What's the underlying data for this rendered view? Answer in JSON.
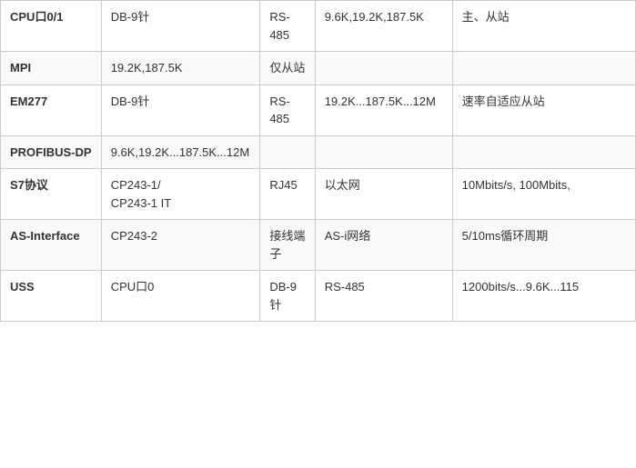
{
  "table": {
    "rows": [
      {
        "protocol": "CPU口0/1",
        "hardware": "DB-9针",
        "interface": "RS-485",
        "network": "9.6K,19.2K,187.5K",
        "notes": "主、从站"
      },
      {
        "protocol": "MPI",
        "hardware": "19.2K,187.5K",
        "interface": "仅从站",
        "network": "",
        "notes": ""
      },
      {
        "protocol": "EM277",
        "hardware": "DB-9针",
        "interface": "RS-485",
        "network": "19.2K...187.5K...12M",
        "notes": "速率自适应从站"
      },
      {
        "protocol": "PROFIBUS-DP",
        "hardware": "9.6K,19.2K...187.5K...12M",
        "interface": "",
        "network": "",
        "notes": ""
      },
      {
        "protocol": "S7协议",
        "hardware": "CP243-1/\nCP243-1 IT",
        "interface": "RJ45",
        "network": "以太网",
        "notes": "10Mbits/s, 100Mbits,"
      },
      {
        "protocol": "AS-Interface",
        "hardware": "CP243-2",
        "interface": "接线端子",
        "network": "AS-i网络",
        "notes": "5/10ms循环周期"
      },
      {
        "protocol": "USS",
        "hardware": "CPU口0",
        "interface": "DB-9针",
        "network": "RS-485",
        "notes": "1200bits/s...9.6K...115"
      }
    ]
  }
}
